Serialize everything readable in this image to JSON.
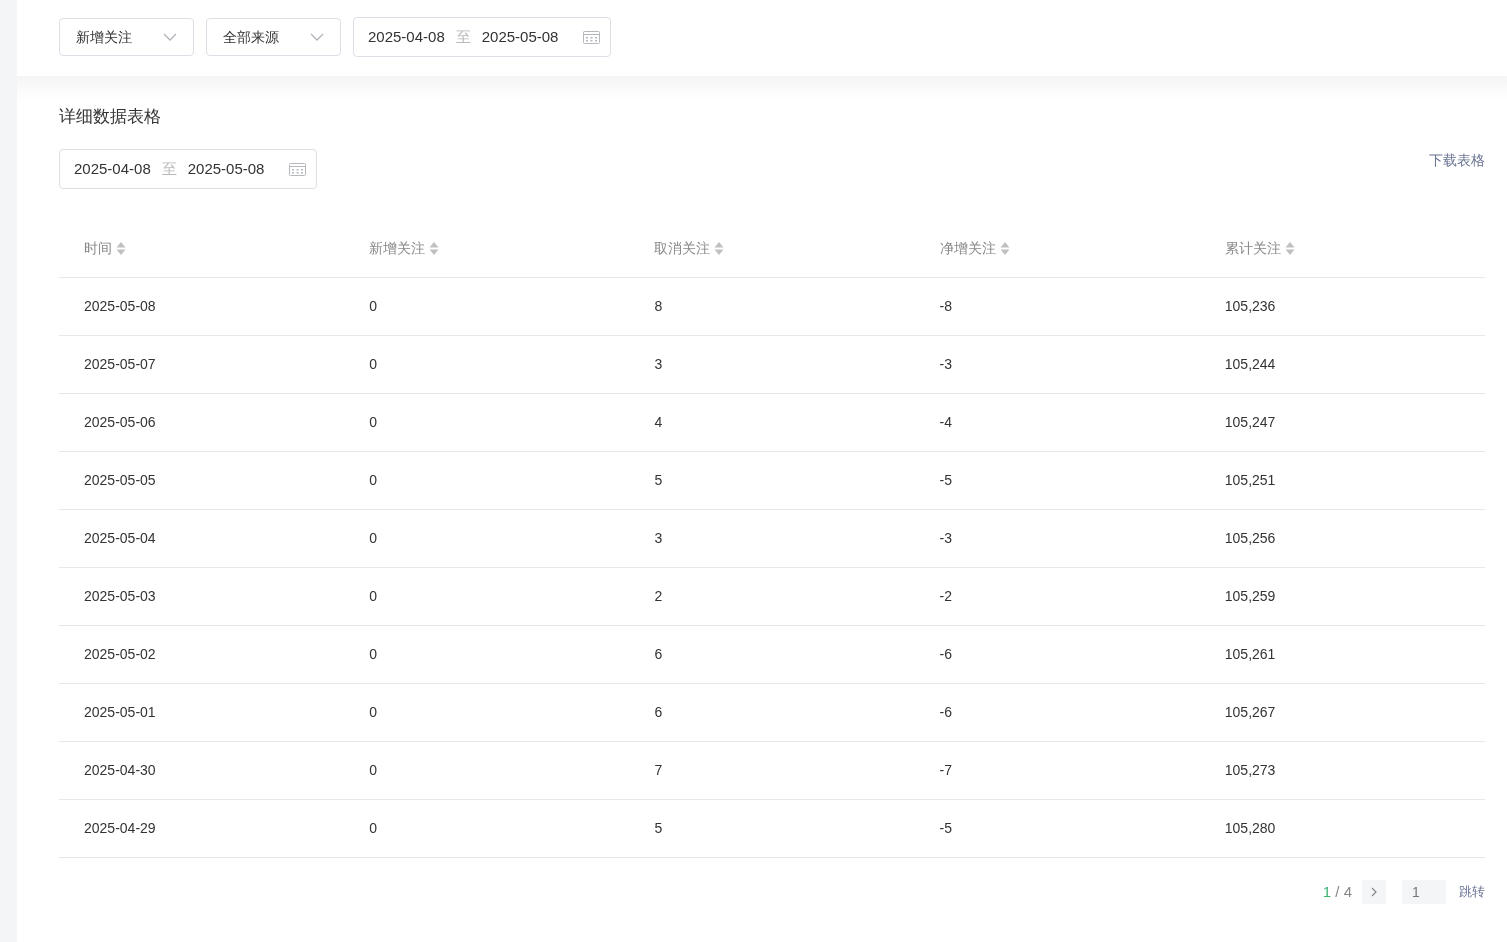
{
  "filters": {
    "type_select": {
      "value": "新增关注"
    },
    "source_select": {
      "value": "全部来源"
    },
    "date_range": {
      "start": "2025-04-08",
      "separator": "至",
      "end": "2025-05-08"
    }
  },
  "table_section": {
    "title": "详细数据表格",
    "date_range": {
      "start": "2025-04-08",
      "separator": "至",
      "end": "2025-05-08"
    },
    "download_link": "下载表格",
    "columns": [
      "时间",
      "新增关注",
      "取消关注",
      "净增关注",
      "累计关注"
    ],
    "rows": [
      [
        "2025-05-08",
        "0",
        "8",
        "-8",
        "105,236"
      ],
      [
        "2025-05-07",
        "0",
        "3",
        "-3",
        "105,244"
      ],
      [
        "2025-05-06",
        "0",
        "4",
        "-4",
        "105,247"
      ],
      [
        "2025-05-05",
        "0",
        "5",
        "-5",
        "105,251"
      ],
      [
        "2025-05-04",
        "0",
        "3",
        "-3",
        "105,256"
      ],
      [
        "2025-05-03",
        "0",
        "2",
        "-2",
        "105,259"
      ],
      [
        "2025-05-02",
        "0",
        "6",
        "-6",
        "105,261"
      ],
      [
        "2025-05-01",
        "0",
        "6",
        "-6",
        "105,267"
      ],
      [
        "2025-04-30",
        "0",
        "7",
        "-7",
        "105,273"
      ],
      [
        "2025-04-29",
        "0",
        "5",
        "-5",
        "105,280"
      ]
    ],
    "pagination": {
      "current": "1",
      "total": "/ 4",
      "jump_placeholder": "1",
      "jump_button": "跳转"
    }
  }
}
